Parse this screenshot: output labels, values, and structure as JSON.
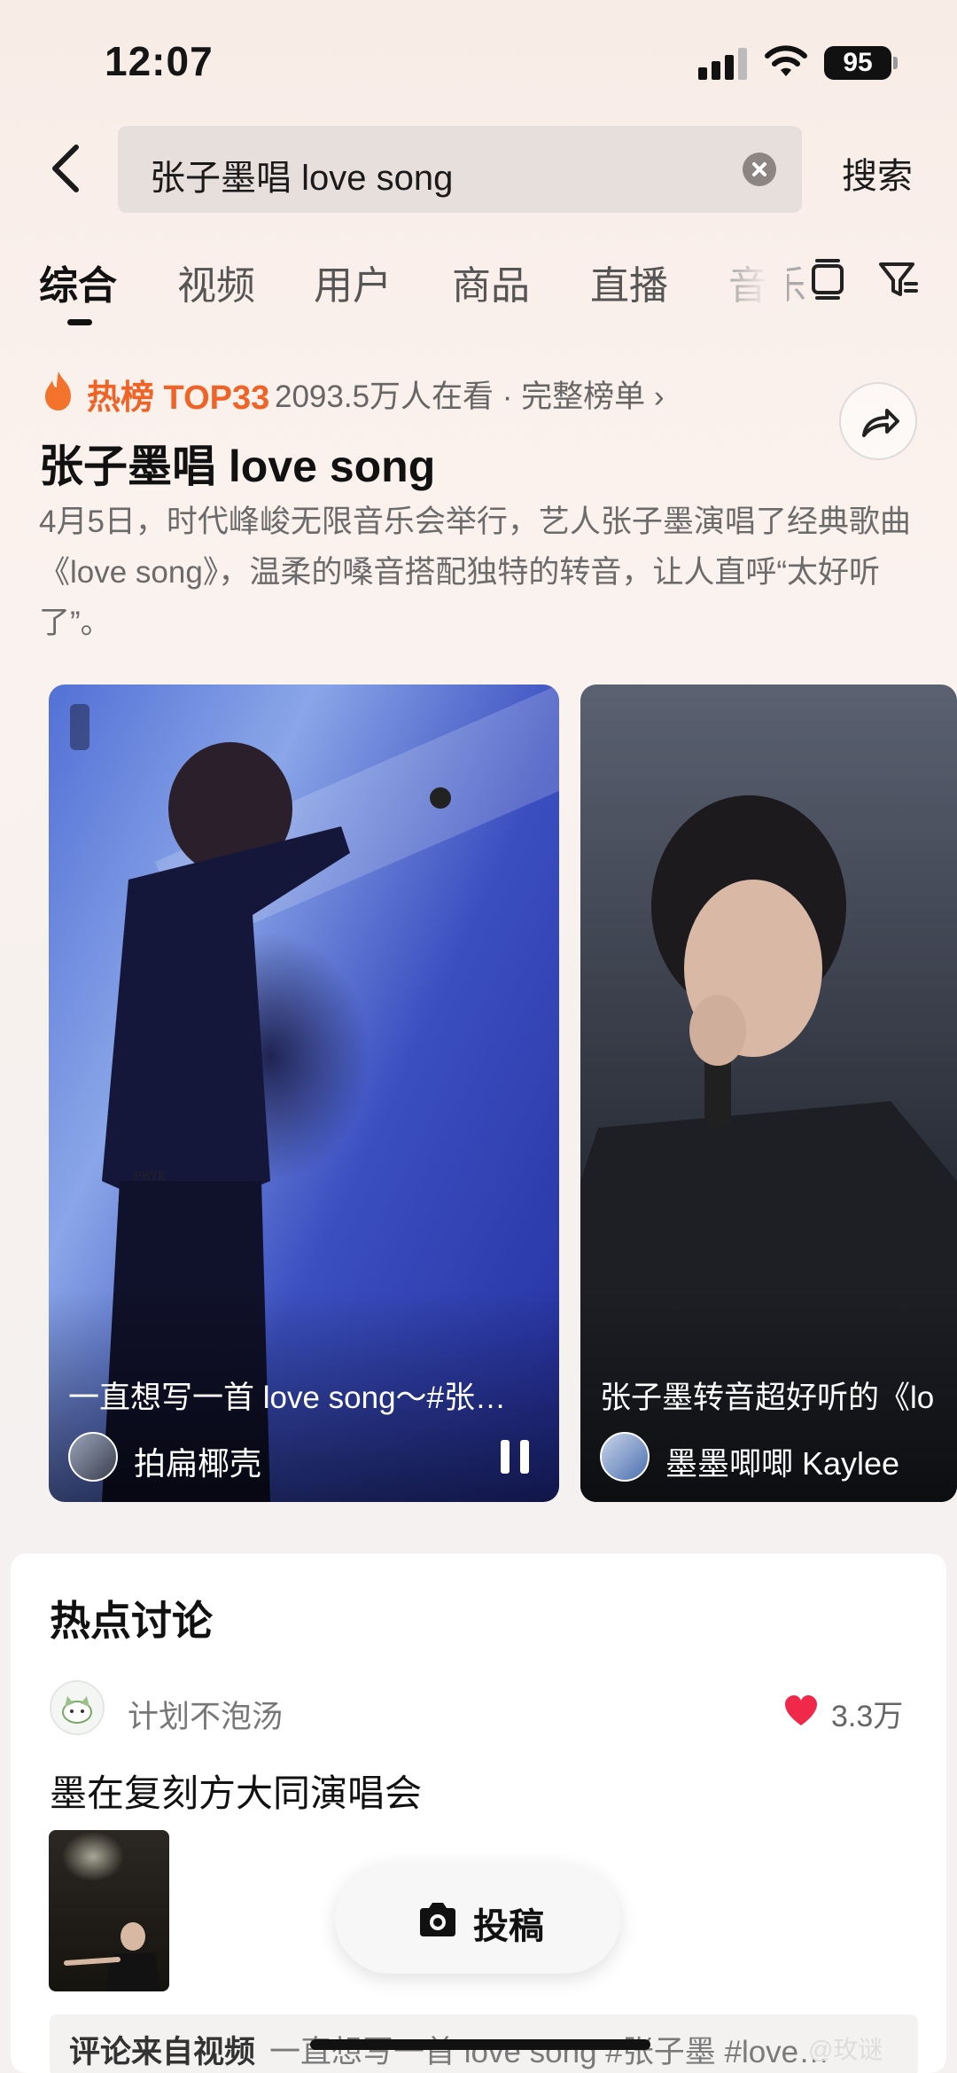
{
  "status_bar": {
    "time": "12:07",
    "battery": "95"
  },
  "search": {
    "query": "张子墨唱 love song",
    "button_label": "搜索"
  },
  "tabs": [
    {
      "label": "综合",
      "active": true
    },
    {
      "label": "视频"
    },
    {
      "label": "用户"
    },
    {
      "label": "商品"
    },
    {
      "label": "直播"
    },
    {
      "label": "音乐"
    }
  ],
  "hot_topic": {
    "badge": "热榜 TOP33",
    "meta": "2093.5万人在看 · 完整榜单 ›",
    "title": "张子墨唱 love song",
    "description": "4月5日，时代峰峻无限音乐会举行，艺人张子墨演唱了经典歌曲《love song》，温柔的嗓音搭配独特的转音，让人直呼“太好听了”。"
  },
  "videos": [
    {
      "caption": "一直想写一首 love song～#张…",
      "author": "拍扁椰壳",
      "watermark": "PBYK"
    },
    {
      "caption": "张子墨转音超好听的《lo",
      "author": "墨墨唧唧 Kaylee"
    }
  ],
  "discussion": {
    "title": "热点讨论",
    "user": "计划不泡汤",
    "likes": "3.3万",
    "post_title": "墨在复刻方大同演唱会",
    "comment_prefix": "评论来自视频",
    "comment_text": "一直想写一首 love song #张子墨 #love…"
  },
  "submit": {
    "label": "投稿"
  },
  "watermark_text": "@玫谜",
  "colors": {
    "accent": "#f06326",
    "heart": "#f0294a",
    "text": "#151515"
  }
}
